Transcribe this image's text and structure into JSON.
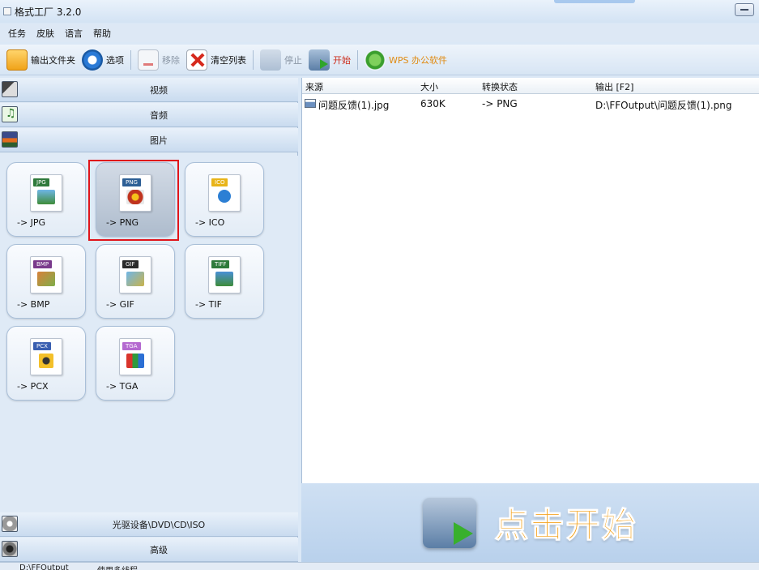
{
  "window": {
    "title": "格式工厂 3.2.0"
  },
  "menu": [
    "任务",
    "皮肤",
    "语言",
    "帮助"
  ],
  "toolbar": {
    "output_folder": "输出文件夹",
    "options": "选项",
    "remove": "移除",
    "clear_list": "清空列表",
    "stop": "停止",
    "start": "开始",
    "wps": "WPS 办公软件"
  },
  "categories": {
    "video": "视频",
    "audio": "音频",
    "picture": "图片",
    "disc": "光驱设备\\DVD\\CD\\ISO",
    "advanced": "高级"
  },
  "formats": [
    {
      "tag": "JPG",
      "label": "-> JPG",
      "tag_color": "#2f7a3c"
    },
    {
      "tag": "PNG",
      "label": "-> PNG",
      "tag_color": "#2d5f95"
    },
    {
      "tag": "ICO",
      "label": "-> ICO",
      "tag_color": "#e8b419"
    },
    {
      "tag": "BMP",
      "label": "-> BMP",
      "tag_color": "#7a3a8c"
    },
    {
      "tag": "GIF",
      "label": "-> GIF",
      "tag_color": "#2b2b2b"
    },
    {
      "tag": "TIFF",
      "label": "-> TIF",
      "tag_color": "#2f7a3c"
    },
    {
      "tag": "PCX",
      "label": "-> PCX",
      "tag_color": "#3a5fb0"
    },
    {
      "tag": "TGA",
      "label": "-> TGA",
      "tag_color": "#b56ad0"
    }
  ],
  "selected_format": "PNG",
  "list": {
    "headers": [
      "来源",
      "大小",
      "转换状态",
      "输出 [F2]"
    ],
    "rows": [
      {
        "source": "问题反馈(1).jpg",
        "size": "630K",
        "status": "-> PNG",
        "output": "D:\\FFOutput\\问题反馈(1).png"
      }
    ]
  },
  "start_banner": "点击开始",
  "status": {
    "left": "D:\\FFOutput",
    "mid": "使用多线程"
  },
  "colors": {
    "accent_start": "#f4a21c",
    "selection_frame": "#e0151b"
  }
}
